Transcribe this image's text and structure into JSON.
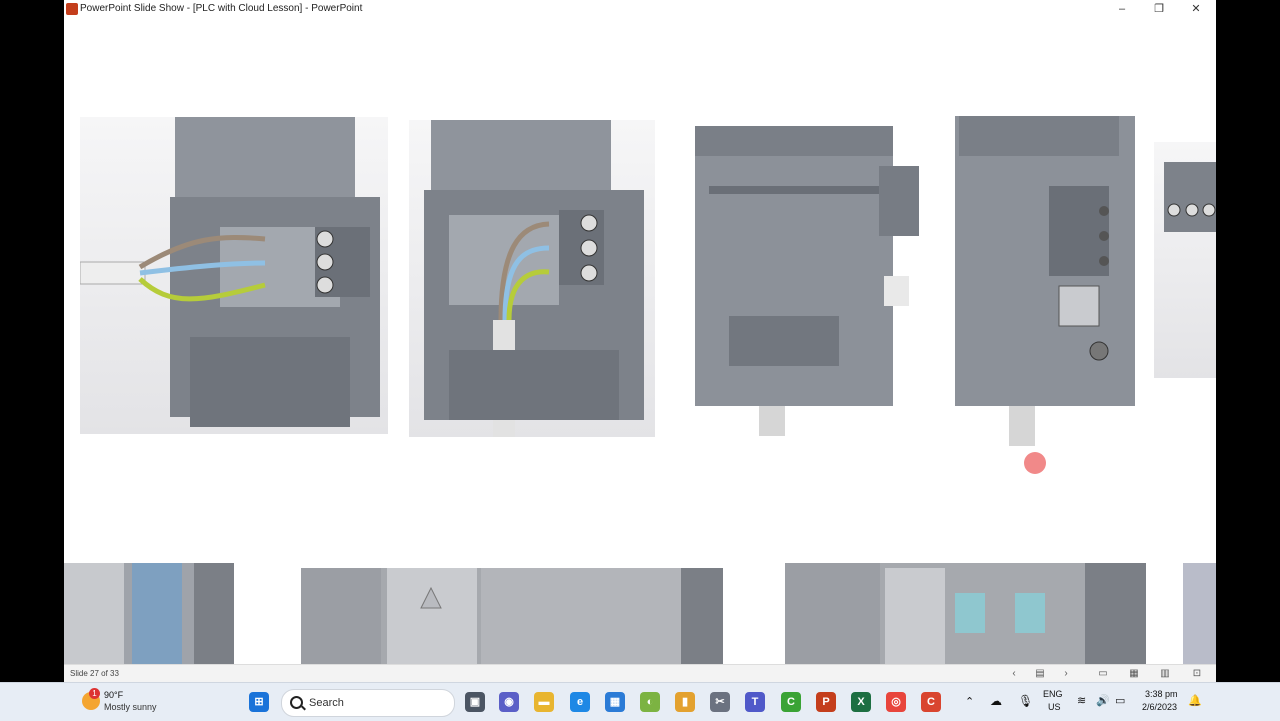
{
  "window": {
    "title": "PowerPoint Slide Show - [PLC with Cloud Lesson] - PowerPoint",
    "minimize": "–",
    "restore": "❐",
    "close": "✕"
  },
  "status": {
    "slide_counter": "Slide 27 of 33"
  },
  "taskbar": {
    "weather_temp": "90°F",
    "weather_condition": "Mostly sunny",
    "weather_badge": "1",
    "search_placeholder": "Search",
    "lang_top": "ENG",
    "lang_bottom": "US",
    "time": "3:38 pm",
    "date": "2/6/2023"
  },
  "icons": {
    "app": "powerpoint-icon",
    "start": "windows-start-icon",
    "search": "search-icon"
  },
  "colors": {
    "powerpoint": "#c43e1c",
    "excel": "#1d6f42",
    "taskbar_bg": "#e7edf5"
  }
}
